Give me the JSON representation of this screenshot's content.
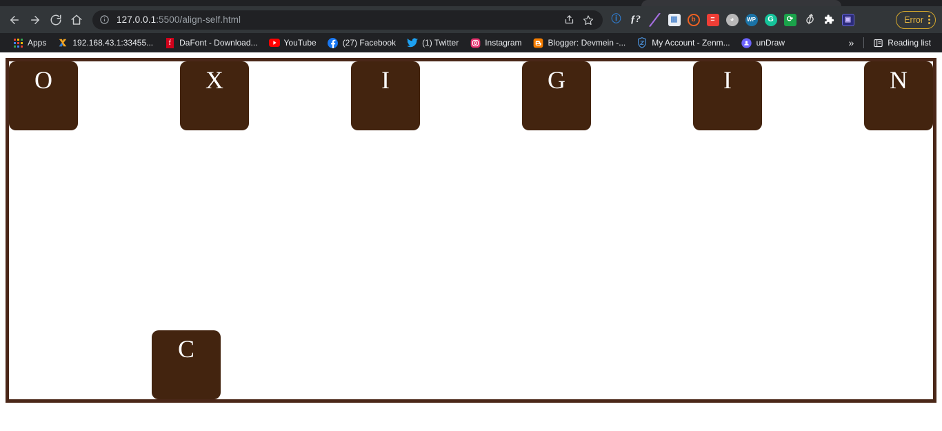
{
  "browser": {
    "nav": {
      "back_label": "Back",
      "forward_label": "Forward",
      "reload_label": "Reload",
      "home_label": "Home"
    },
    "omnibox": {
      "info_icon": "info-circle-icon",
      "url_host": "127.0.0.1",
      "url_rest": ":5500/align-self.html",
      "url_full": "127.0.0.1:5500/align-self.html",
      "share_icon": "share-icon",
      "bookmark_icon": "star-icon"
    },
    "extensions": [
      {
        "name": "bitwarden-extension",
        "glyph": "b",
        "fg": "#2f7fd6",
        "bg": "transparent",
        "shape": "text"
      },
      {
        "name": "fonts-ninja-extension",
        "glyph": "ƒ?",
        "fg": "#e8eaed",
        "bg": "transparent",
        "shape": "text"
      },
      {
        "name": "color-picker-extension",
        "glyph": "╱",
        "fg": "#a56ee0",
        "bg": "transparent",
        "shape": "text"
      },
      {
        "name": "window-resizer-extension",
        "glyph": "▤",
        "fg": "#6fa8dc",
        "bg": "#e9eef5",
        "shape": "sq"
      },
      {
        "name": "bitly-extension",
        "glyph": "b",
        "fg": "#ee6123",
        "bg": "transparent",
        "shape": "circ-outline"
      },
      {
        "name": "stylebot-extension",
        "glyph": "≡",
        "fg": "#ffffff",
        "bg": "#ef3e36",
        "shape": "sq"
      },
      {
        "name": "grey-disc-extension",
        "glyph": "●",
        "fg": "#ffffff",
        "bg": "#b9b9b9",
        "shape": "circ"
      },
      {
        "name": "wordpress-extension",
        "glyph": "WP",
        "fg": "#ffffff",
        "bg": "#1a73a7",
        "shape": "circ"
      },
      {
        "name": "grammarly-extension",
        "glyph": "G",
        "fg": "#ffffff",
        "bg": "#15c39a",
        "shape": "circ"
      },
      {
        "name": "sync-extension",
        "glyph": "⟳",
        "fg": "#ffffff",
        "bg": "#1aa34a",
        "shape": "sq"
      },
      {
        "name": "similarweb-extension",
        "glyph": "S",
        "fg": "#dddddd",
        "bg": "transparent",
        "shape": "text"
      },
      {
        "name": "puzzle-extensions-button",
        "glyph": "✦",
        "fg": "#ffffff",
        "bg": "transparent",
        "shape": "puzzle"
      },
      {
        "name": "screen-recorder-extension",
        "glyph": "▣",
        "fg": "#c9b8ff",
        "bg": "#2b2b7a",
        "shape": "sq"
      }
    ],
    "error_chip": {
      "label": "Error",
      "menu_icon": "kebab-menu-icon"
    },
    "bookmarks": [
      {
        "name": "apps",
        "label": "Apps",
        "icon": "apps-grid-icon"
      },
      {
        "name": "local-server",
        "label": "192.168.43.1:33455...",
        "icon": "xampp-icon",
        "color": "#f5a623"
      },
      {
        "name": "dafont",
        "label": "DaFont - Download...",
        "icon": "dafont-icon",
        "color": "#d0021b"
      },
      {
        "name": "youtube",
        "label": "YouTube",
        "icon": "youtube-icon",
        "color": "#ff0000"
      },
      {
        "name": "facebook",
        "label": "(27) Facebook",
        "icon": "facebook-icon",
        "color": "#1877f2"
      },
      {
        "name": "twitter",
        "label": "(1) Twitter",
        "icon": "twitter-icon",
        "color": "#1da1f2"
      },
      {
        "name": "instagram",
        "label": "Instagram",
        "icon": "instagram-icon",
        "color": "#e1306c"
      },
      {
        "name": "blogger",
        "label": "Blogger: Devmein -...",
        "icon": "blogger-icon",
        "color": "#f57d00"
      },
      {
        "name": "zenmate",
        "label": "My Account - Zenm...",
        "icon": "zenmate-shield-icon",
        "color": "#4a90d9"
      },
      {
        "name": "undraw",
        "label": "unDraw",
        "icon": "undraw-icon",
        "color": "#6c63ff"
      }
    ],
    "bookmarks_overflow_icon": "chevron-double-right-icon",
    "reading_list": {
      "label": "Reading list",
      "icon": "reading-list-icon"
    }
  },
  "page": {
    "container_border_color": "#4a2718",
    "box_color": "#43240f",
    "text_color": "#ffffff",
    "items": [
      {
        "letter": "O",
        "align_self": "flex-start"
      },
      {
        "letter": "X",
        "align_self": "flex-start"
      },
      {
        "letter": "I",
        "align_self": "flex-start"
      },
      {
        "letter": "G",
        "align_self": "flex-start"
      },
      {
        "letter": "I",
        "align_self": "flex-start"
      },
      {
        "letter": "N",
        "align_self": "flex-start"
      },
      {
        "letter": "C",
        "align_self": "flex-end"
      }
    ]
  }
}
